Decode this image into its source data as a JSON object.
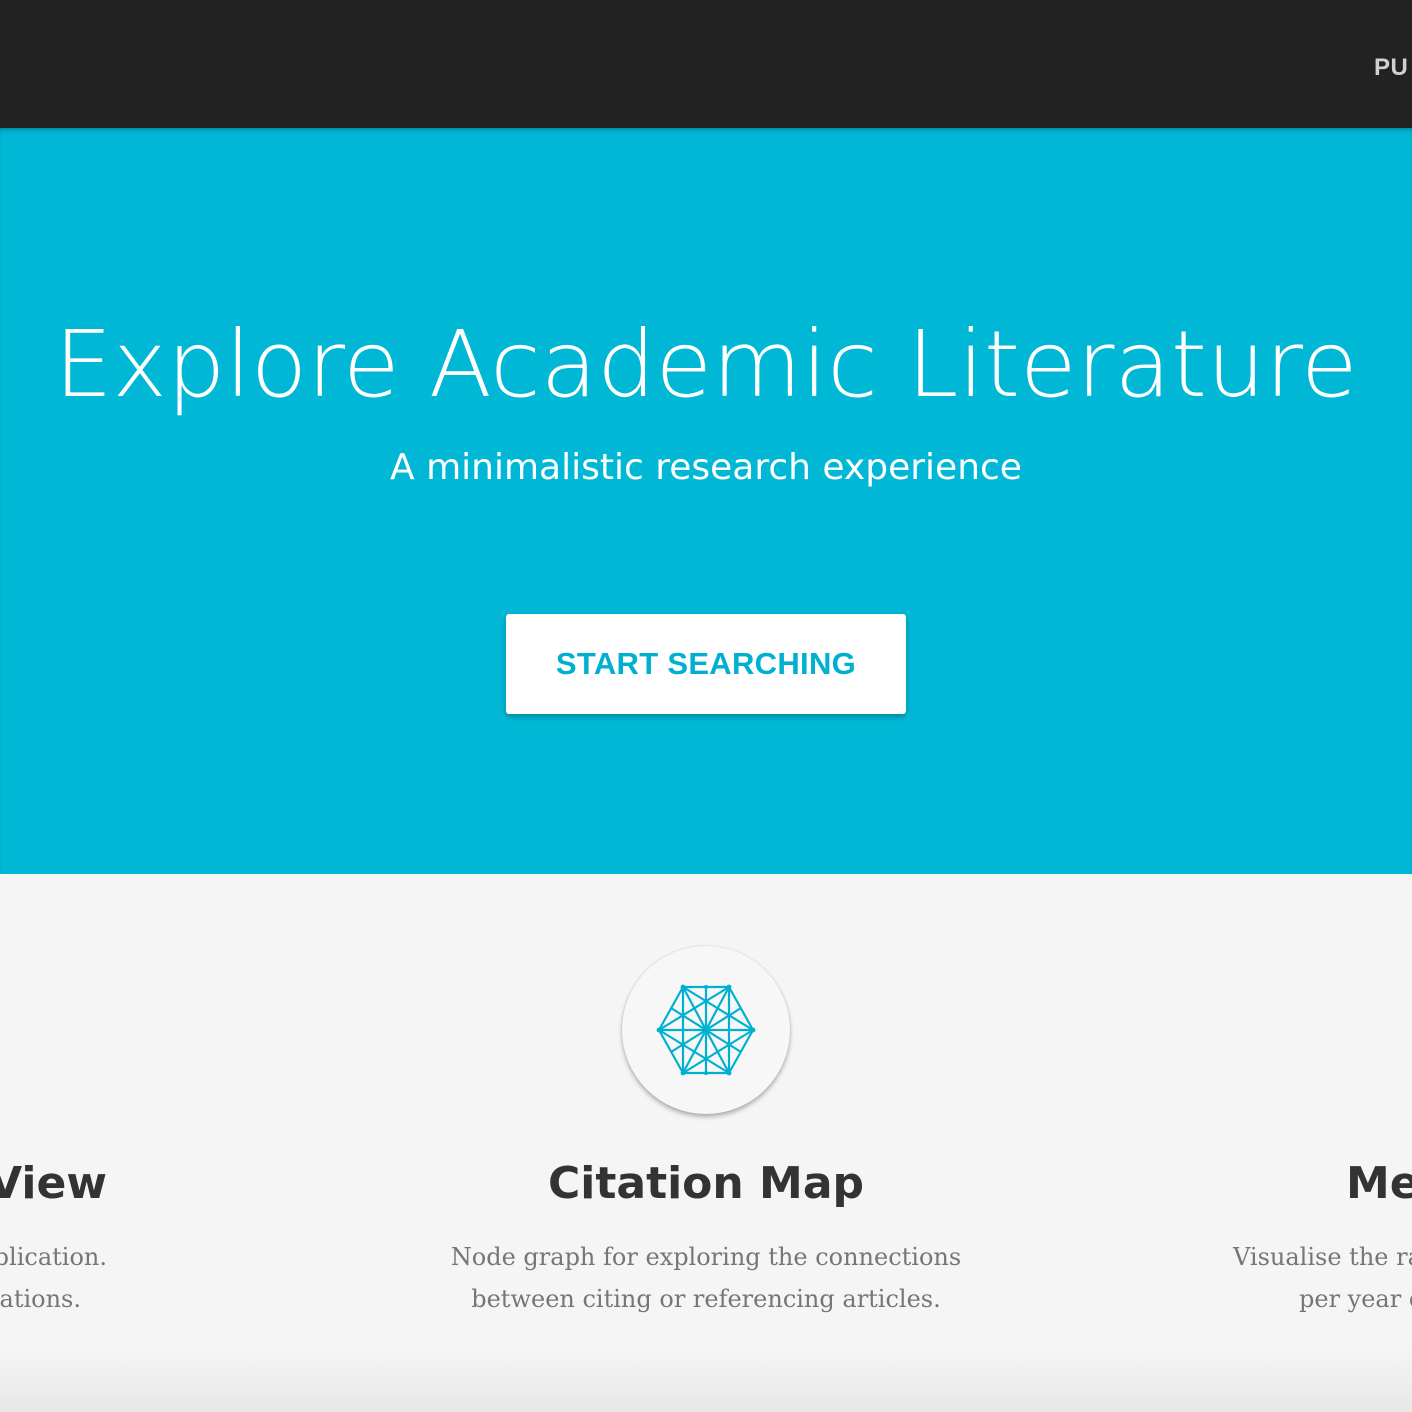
{
  "nav": {
    "link_partial": "PU"
  },
  "hero": {
    "title": "Explore Academic Literature",
    "subtitle": "A minimalistic research experience",
    "button_label": "START SEARCHING"
  },
  "features": [
    {
      "title_visible": "View",
      "desc_line1_visible": "demic publication.",
      "desc_line2_visible": "ces or citations."
    },
    {
      "title": "Citation Map",
      "desc_line1": "Node graph for exploring the connections",
      "desc_line2": "between citing or referencing articles.",
      "icon": "network-graph-icon"
    },
    {
      "title_visible": "Me",
      "desc_line1_visible": "Visualise the rat",
      "desc_line2_visible": "per year c"
    }
  ],
  "colors": {
    "topbar": "#222222",
    "hero_bg": "#00b8d6",
    "accent": "#00b0d1",
    "features_bg": "#f5f5f5"
  }
}
